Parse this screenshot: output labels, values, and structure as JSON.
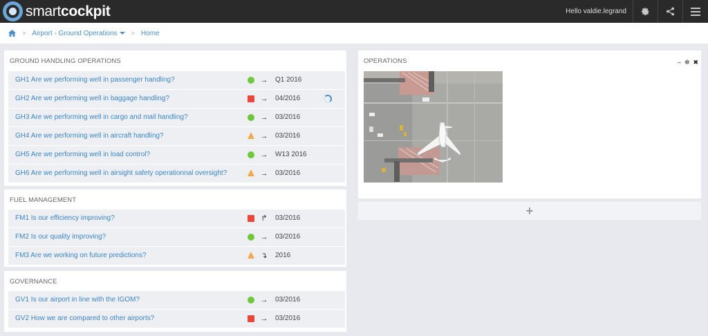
{
  "header": {
    "logo_light": "smart",
    "logo_bold": "cockpit",
    "greeting": "Hello valdie.legrand",
    "icons": [
      "gear-icon",
      "share-icon",
      "menu-icon"
    ]
  },
  "breadcrumb": {
    "home_icon": "home-icon",
    "items": [
      "Airport - Ground Operations",
      "Home"
    ]
  },
  "panels": {
    "ground_handling": {
      "title": "GROUND HANDLING OPERATIONS",
      "rows": [
        {
          "question": "GH1 Are we performing well in passenger handling?",
          "status": "green",
          "trend": "→",
          "period": "Q1 2016"
        },
        {
          "question": "GH2 Are we performing well in baggage handling?",
          "status": "red",
          "trend": "→",
          "period": "04/2016"
        },
        {
          "question": "GH3 Are we performing well in cargo and mail handling?",
          "status": "green",
          "trend": "→",
          "period": "03/2016"
        },
        {
          "question": "GH4 Are we performing well in aircraft handling?",
          "status": "orange",
          "trend": "→",
          "period": "03/2016"
        },
        {
          "question": "GH5 Are we performing well in load control?",
          "status": "green",
          "trend": "→",
          "period": "W13 2016"
        },
        {
          "question": "GH6 Are we performing well in airsight safety operationnal oversight?",
          "status": "orange",
          "trend": "→",
          "period": "03/2016"
        }
      ]
    },
    "fuel": {
      "title": "FUEL MANAGEMENT",
      "rows": [
        {
          "question": "FM1 Is our efficiency improving?",
          "status": "red",
          "trend": "↱",
          "period": "03/2016"
        },
        {
          "question": "FM2 Is our quality improving?",
          "status": "green",
          "trend": "→",
          "period": "03/2016"
        },
        {
          "question": "FM3 Are we working on future predictions?",
          "status": "orange",
          "trend": "↴",
          "period": "2016"
        }
      ]
    },
    "governance": {
      "title": "GOVERNANCE",
      "rows": [
        {
          "question": "GV1 Is our airport in line with the IGOM?",
          "status": "green",
          "trend": "→",
          "period": "03/2016"
        },
        {
          "question": "GV2 How we are compared to other airports?",
          "status": "red",
          "trend": "→",
          "period": "03/2016"
        }
      ]
    },
    "operations": {
      "title": "OPERATIONS",
      "controls": {
        "minimize": "–",
        "settings": "✲",
        "close": "✖"
      }
    }
  },
  "add_widget": {
    "label": "+"
  },
  "colors": {
    "green": "#6dc83c",
    "red": "#e8483b",
    "orange": "#f3a94a",
    "link": "#3a86c3"
  }
}
